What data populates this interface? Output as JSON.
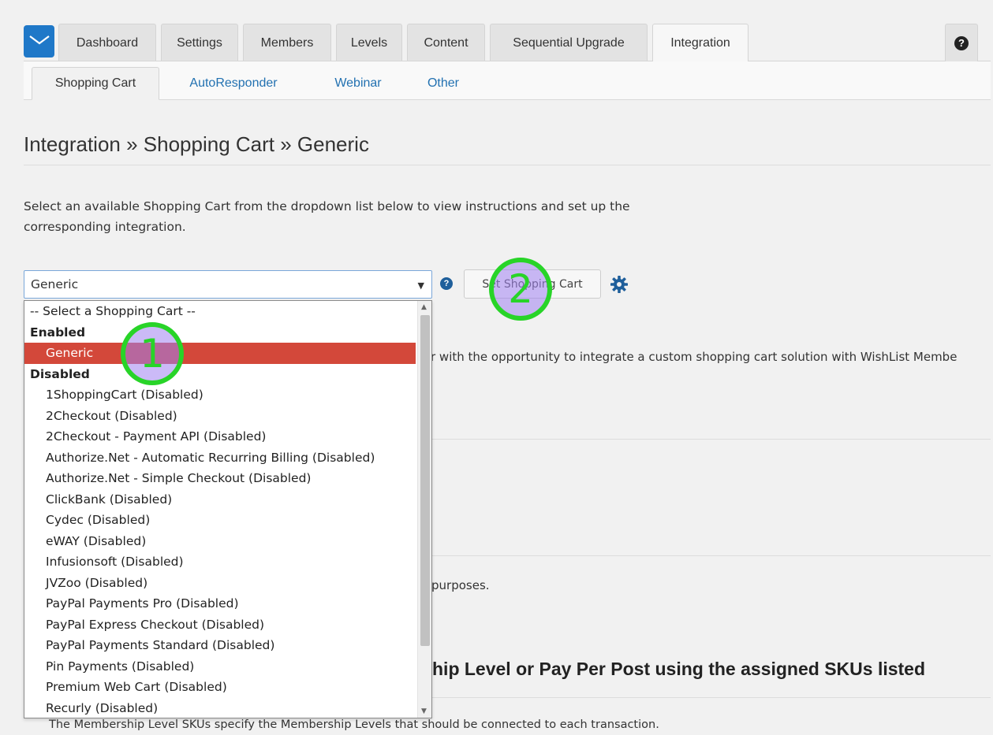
{
  "nav": {
    "tabs": [
      {
        "label": "Dashboard"
      },
      {
        "label": "Settings"
      },
      {
        "label": "Members"
      },
      {
        "label": "Levels"
      },
      {
        "label": "Content"
      },
      {
        "label": "Sequential Upgrade"
      },
      {
        "label": "Integration"
      }
    ],
    "active_tab": "Integration",
    "help_icon": "question-circle-icon"
  },
  "subnav": {
    "tabs": [
      {
        "label": "Shopping Cart"
      },
      {
        "label": "AutoResponder"
      },
      {
        "label": "Webinar"
      },
      {
        "label": "Other"
      }
    ],
    "active_tab": "Shopping Cart"
  },
  "page": {
    "title": "Integration » Shopping Cart » Generic",
    "description": "Select an available Shopping Cart from the dropdown list below to view instructions and set up the corresponding integration."
  },
  "cart_select": {
    "value": "Generic",
    "set_button": "Set Shopping Cart",
    "options": [
      {
        "label": "-- Select a Shopping Cart --",
        "kind": "placeholder"
      },
      {
        "label": "Enabled",
        "kind": "group"
      },
      {
        "label": "Generic",
        "kind": "option",
        "selected": true
      },
      {
        "label": "Disabled",
        "kind": "group"
      },
      {
        "label": "1ShoppingCart (Disabled)",
        "kind": "option"
      },
      {
        "label": "2Checkout (Disabled)",
        "kind": "option"
      },
      {
        "label": "2Checkout - Payment API (Disabled)",
        "kind": "option"
      },
      {
        "label": "Authorize.Net - Automatic Recurring Billing (Disabled)",
        "kind": "option"
      },
      {
        "label": "Authorize.Net - Simple Checkout (Disabled)",
        "kind": "option"
      },
      {
        "label": "ClickBank (Disabled)",
        "kind": "option"
      },
      {
        "label": "Cydec (Disabled)",
        "kind": "option"
      },
      {
        "label": "eWAY (Disabled)",
        "kind": "option"
      },
      {
        "label": "Infusionsoft (Disabled)",
        "kind": "option"
      },
      {
        "label": "JVZoo (Disabled)",
        "kind": "option"
      },
      {
        "label": "PayPal Payments Pro (Disabled)",
        "kind": "option"
      },
      {
        "label": "PayPal Express Checkout (Disabled)",
        "kind": "option"
      },
      {
        "label": "PayPal Payments Standard (Disabled)",
        "kind": "option"
      },
      {
        "label": "Pin Payments (Disabled)",
        "kind": "option"
      },
      {
        "label": "Premium Web Cart (Disabled)",
        "kind": "option"
      },
      {
        "label": "Recurly (Disabled)",
        "kind": "option"
      }
    ]
  },
  "background": {
    "intro_fragment": "r with the opportunity to integrate a custom shopping cart solution with WishList Membe",
    "purposes_fragment": "purposes.",
    "heading_fragment": "hip Level or Pay Per Post using the assigned SKUs listed",
    "sku_note": "The Membership Level SKUs specify the Membership Levels that should be connected to each transaction."
  },
  "annotations": {
    "marker_1": "1",
    "marker_2": "2",
    "color": "#28d428"
  }
}
